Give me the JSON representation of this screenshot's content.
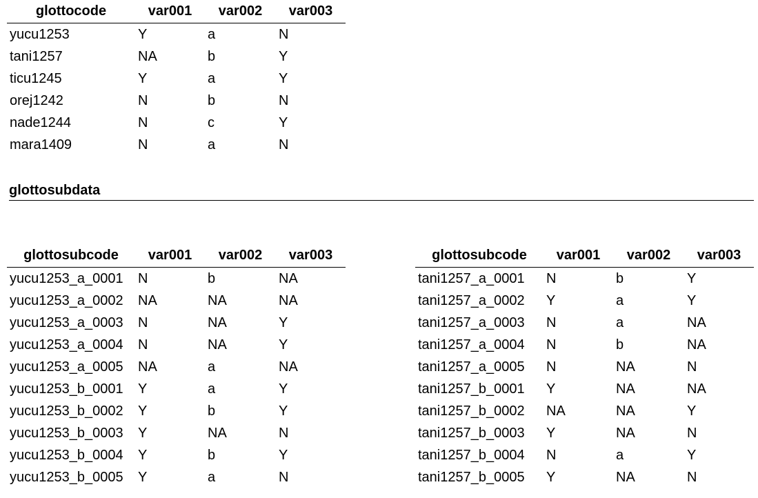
{
  "glotto_table": {
    "columns": [
      "glottocode",
      "var001",
      "var002",
      "var003"
    ],
    "rows": [
      [
        "yucu1253",
        "Y",
        "a",
        "N"
      ],
      [
        "tani1257",
        "NA",
        "b",
        "Y"
      ],
      [
        "ticu1245",
        "Y",
        "a",
        "Y"
      ],
      [
        "orej1242",
        "N",
        "b",
        "N"
      ],
      [
        "nade1244",
        "N",
        "c",
        "Y"
      ],
      [
        "mara1409",
        "N",
        "a",
        "N"
      ]
    ]
  },
  "subdata_heading": "glottosubdata",
  "subdata_left": {
    "columns": [
      "glottosubcode",
      "var001",
      "var002",
      "var003"
    ],
    "rows": [
      [
        "yucu1253_a_0001",
        "N",
        "b",
        "NA"
      ],
      [
        "yucu1253_a_0002",
        "NA",
        "NA",
        "NA"
      ],
      [
        "yucu1253_a_0003",
        "N",
        "NA",
        "Y"
      ],
      [
        "yucu1253_a_0004",
        "N",
        "NA",
        "Y"
      ],
      [
        "yucu1253_a_0005",
        "NA",
        "a",
        "NA"
      ],
      [
        "yucu1253_b_0001",
        "Y",
        "a",
        "Y"
      ],
      [
        "yucu1253_b_0002",
        "Y",
        "b",
        "Y"
      ],
      [
        "yucu1253_b_0003",
        "Y",
        "NA",
        "N"
      ],
      [
        "yucu1253_b_0004",
        "Y",
        "b",
        "Y"
      ],
      [
        "yucu1253_b_0005",
        "Y",
        "a",
        "N"
      ]
    ]
  },
  "subdata_right": {
    "columns": [
      "glottosubcode",
      "var001",
      "var002",
      "var003"
    ],
    "rows": [
      [
        "tani1257_a_0001",
        "N",
        "b",
        "Y"
      ],
      [
        "tani1257_a_0002",
        "Y",
        "a",
        "Y"
      ],
      [
        "tani1257_a_0003",
        "N",
        "a",
        "NA"
      ],
      [
        "tani1257_a_0004",
        "N",
        "b",
        "NA"
      ],
      [
        "tani1257_a_0005",
        "N",
        "NA",
        "N"
      ],
      [
        "tani1257_b_0001",
        "Y",
        "NA",
        "NA"
      ],
      [
        "tani1257_b_0002",
        "NA",
        "NA",
        "Y"
      ],
      [
        "tani1257_b_0003",
        "Y",
        "NA",
        "N"
      ],
      [
        "tani1257_b_0004",
        "N",
        "a",
        "Y"
      ],
      [
        "tani1257_b_0005",
        "Y",
        "NA",
        "N"
      ]
    ]
  }
}
